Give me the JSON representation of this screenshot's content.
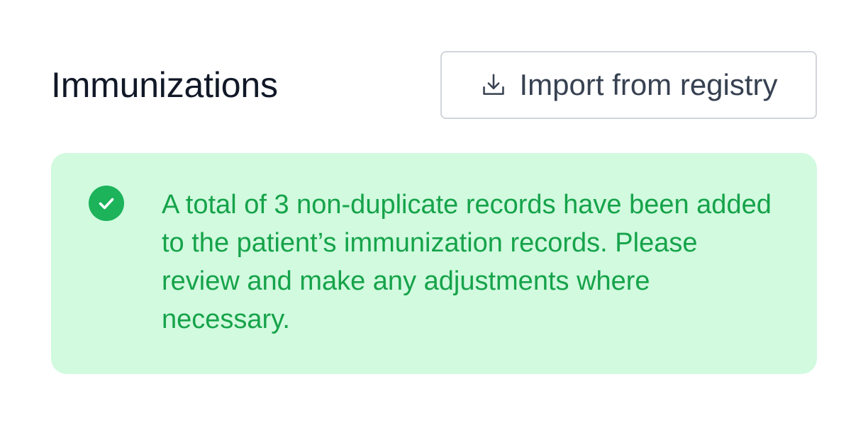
{
  "section": {
    "title": "Immunizations"
  },
  "toolbar": {
    "import_label": "Import from registry",
    "import_icon": "download-icon"
  },
  "alert": {
    "icon": "check-circle-icon",
    "status": "success",
    "message": "A total of 3 non-duplicate records have been added to the patient’s immunization records. Please review and make any adjustments where necessary."
  },
  "colors": {
    "title": "#111827",
    "button_border": "#d1d5db",
    "button_text": "#374151",
    "alert_bg": "#d1fadf",
    "alert_text": "#16a34a",
    "success_icon": "#1cb35b"
  }
}
